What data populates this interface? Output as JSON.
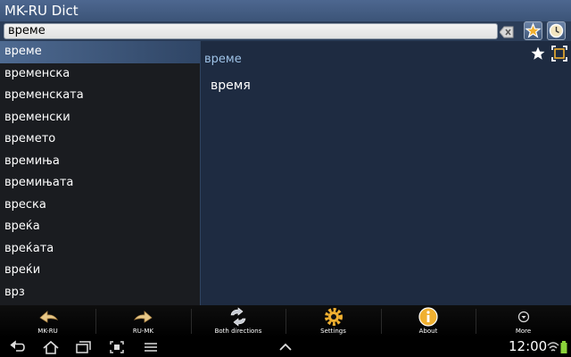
{
  "app": {
    "title": "MK-RU Dict"
  },
  "search": {
    "value": "време"
  },
  "word_list": [
    "време",
    "временска",
    "временската",
    "временски",
    "времето",
    "времиња",
    "времињата",
    "вреска",
    "вреќа",
    "вреќата",
    "вреќи",
    "врз"
  ],
  "entry": {
    "headword": "време",
    "translation": "время"
  },
  "actions": [
    {
      "label": "MK-RU",
      "icon": "arrow-left-icon"
    },
    {
      "label": "RU-MK",
      "icon": "arrow-right-icon"
    },
    {
      "label": "Both directions",
      "icon": "swap-arrows-icon"
    },
    {
      "label": "Settings",
      "icon": "gear-icon"
    },
    {
      "label": "About",
      "icon": "info-icon"
    },
    {
      "label": "More",
      "icon": "more-icon"
    }
  ],
  "status": {
    "time": "12:00"
  },
  "colors": {
    "titlebar": "#4d6790",
    "selection": "#4e6a91",
    "headword": "#9ec2e6",
    "accent": "#f0b030"
  }
}
